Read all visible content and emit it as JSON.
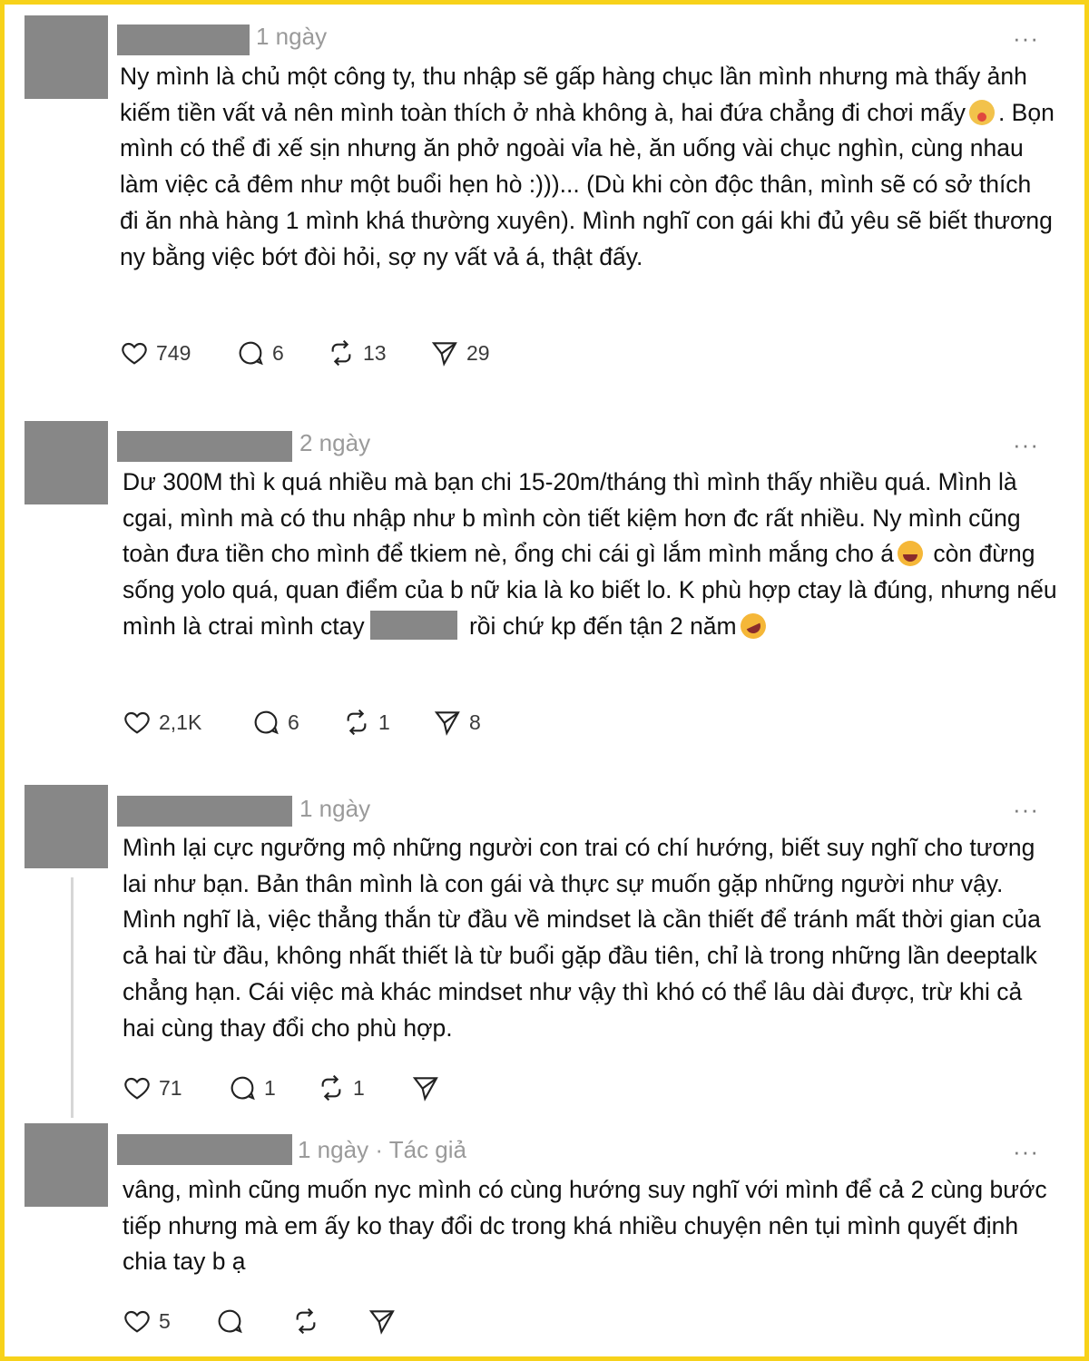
{
  "theme": {
    "border": "#f7d21a",
    "redaction": "#878787",
    "meta_text": "#9a9a9a"
  },
  "more_label": "···",
  "posts": [
    {
      "time": "1 ngày",
      "text_parts": [
        "Ny mình là chủ một công ty, thu nhập sẽ gấp hàng chục lần mình nhưng mà thấy ảnh kiếm tiền vất vả nên mình toàn thích ở nhà không à, hai đứa chẳng đi chơi mấy",
        ". Bọn mình có thể đi xế sịn nhưng ăn phở ngoài vỉa hè, ăn uống vài chục nghìn, cùng nhau làm việc cả đêm như một buổi hẹn hò :)))... (Dù khi còn độc thân, mình sẽ có sở thích đi ăn nhà hàng 1 mình khá thường xuyên). Mình nghĩ con gái khi đủ yêu sẽ biết thương ny bằng việc bớt đòi hỏi, sợ ny vất vả á, thật đấy."
      ],
      "emoji": "clown-face",
      "likes": "749",
      "replies": "6",
      "reposts": "13",
      "shares": "29"
    },
    {
      "time": "2 ngày",
      "text_parts": [
        "Dư 300M thì k quá nhiều mà bạn chi 15-20m/tháng thì mình thấy nhiều quá. Mình là cgai, mình mà có thu nhập như b mình còn tiết kiệm hơn đc rất nhiều. Ny mình cũng toàn đưa tiền cho mình để tkiem nè, ổng chi cái gì lắm mình mắng cho á",
        " còn đừng sống yolo quá, quan điểm của b nữ kia là ko biết lo. K phù hợp ctay là đúng, nhưng nếu mình là ctrai mình ctay",
        " rồi chứ kp đến tận 2 năm"
      ],
      "emojis": [
        "grinning-face",
        "rolling-on-floor-laughing"
      ],
      "likes": "2,1K",
      "replies": "6",
      "reposts": "1",
      "shares": "8"
    },
    {
      "time": "1 ngày",
      "text": "Mình lại cực ngưỡng mộ những người con trai có chí hướng, biết suy nghĩ cho tương lai như bạn. Bản thân mình là con gái và thực sự muốn gặp những người như vậy. Mình nghĩ là, việc thẳng thắn từ đầu về mindset là cần thiết để tránh mất thời gian của cả hai từ đầu, không nhất thiết là từ buổi gặp đầu tiên, chỉ là trong những lần deeptalk chẳng hạn. Cái việc mà khác mindset như vậy thì khó có thể lâu dài được, trừ khi cả hai cùng thay đổi cho phù hợp.",
      "likes": "71",
      "replies": "1",
      "reposts": "1"
    },
    {
      "time": "1 ngày",
      "author_tag": "· Tác giả",
      "text": "vâng, mình cũng muốn nyc mình có cùng hướng suy nghĩ với mình để cả 2 cùng bước tiếp nhưng mà em ấy ko thay đổi dc trong khá nhiều chuyện nên tụi mình quyết định chia tay b ạ",
      "likes": "5"
    }
  ]
}
